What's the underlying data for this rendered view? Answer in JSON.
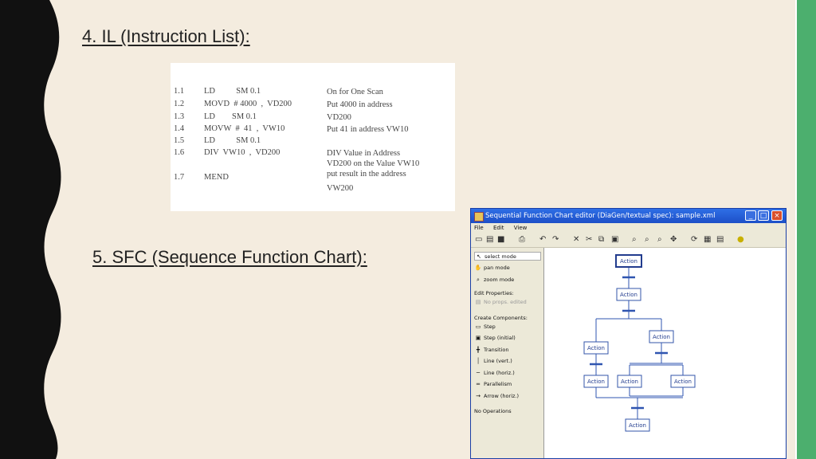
{
  "slide": {
    "heading_il": "4. IL (Instruction List):",
    "heading_sfc": "5. SFC (Sequence Function Chart):"
  },
  "il_lines": [
    {
      "num": "1.1",
      "op": "LD          SM 0.1",
      "comment": "On for One Scan"
    },
    {
      "num": "1.2",
      "op": "MOVD  # 4000  ,  VD200",
      "comment": "Put 4000 in address"
    },
    {
      "num": "1.3",
      "op": "LD        SM 0.1",
      "comment": "VD200"
    },
    {
      "num": "1.4",
      "op": "MOVW  #  41  ,  VW10",
      "comment": "Put 41 in address VW10"
    },
    {
      "num": "1.5",
      "op": "LD          SM 0.1",
      "comment": ""
    },
    {
      "num": "1.6",
      "op": "DIV  VW10  ,  VD200",
      "comment": "DIV Value in Address"
    },
    {
      "num": "",
      "op": "",
      "comment": "VD200 on the Value VW10"
    },
    {
      "num": "",
      "op": "",
      "comment": "put result in the address"
    },
    {
      "num": "1.7",
      "op": "MEND",
      "comment": "VW200"
    }
  ],
  "sfc_window": {
    "title": "Sequential Function Chart editor (DiaGen/textual spec): sample.xml",
    "menu": [
      "File",
      "Edit",
      "View"
    ],
    "win_buttons": {
      "min": "_",
      "max": "□",
      "close": "×"
    },
    "palette": {
      "modes": [
        "select mode",
        "pan mode",
        "zoom mode"
      ],
      "edit_properties_label": "Edit Properties:",
      "edit_properties_value": "No props. edited",
      "create_label": "Create Components:",
      "components": [
        "Step",
        "Step (initial)",
        "Transition",
        "Line (vert.)",
        "Line (horiz.)",
        "Parallelism",
        "Arrow (horiz.)"
      ],
      "operations_label": "No Operations"
    },
    "action_label": "Action"
  },
  "colors": {
    "background": "#f4ecdf",
    "accent_green": "#4caf6e",
    "sfc_blue": "#2f55b0"
  }
}
